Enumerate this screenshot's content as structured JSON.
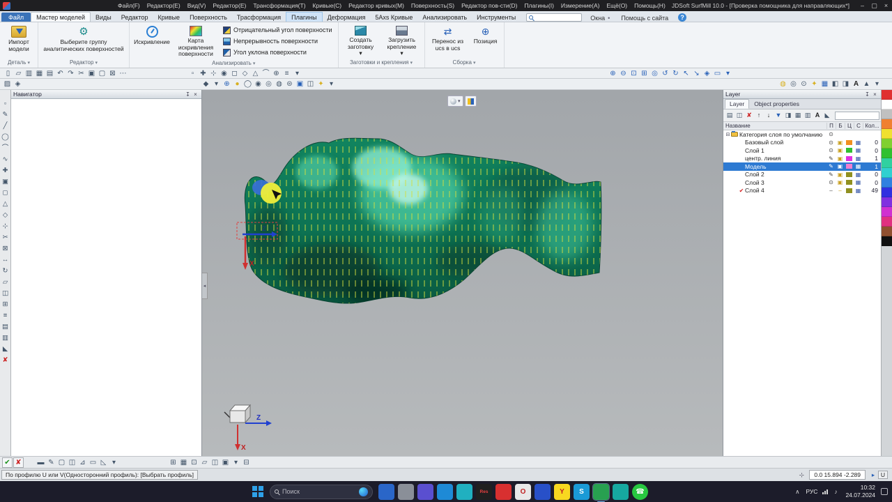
{
  "window": {
    "title": "JDSoft SurfMill 10.0 - [Проверка помощника для направляющих*]"
  },
  "menubar": {
    "items": [
      "Файл(F)",
      "Редактор(E)",
      "Вид(V)",
      "Редактор(E)",
      "Трансформация(T)",
      "Кривые(C)",
      "Редактор кривых(M)",
      "Поверхность(S)",
      "Редактор пов-сти(D)",
      "Плагины(I)",
      "Измерение(A)",
      "Ещё(O)",
      "Помощь(H)"
    ]
  },
  "tabs": {
    "items": [
      {
        "label": "Файл",
        "cls": "file"
      },
      {
        "label": "Мастер моделей",
        "cls": "active"
      },
      {
        "label": "Виды"
      },
      {
        "label": "Редактор"
      },
      {
        "label": "Кривые"
      },
      {
        "label": "Поверхность"
      },
      {
        "label": "Трасформация"
      },
      {
        "label": "Плагины",
        "cls": "hl"
      },
      {
        "label": "Деформация"
      },
      {
        "label": "5Axs Кривые"
      },
      {
        "label": "Анализировать"
      },
      {
        "label": "Инструменты"
      }
    ],
    "right_links": [
      "Окна",
      "Помощь с сайта"
    ]
  },
  "ribbon": {
    "import_btn": "Импорт модели",
    "select_btn": "Выберите группу аналитических поверхностей",
    "curvature_btn": "Искривление",
    "curvature_map_btn": "Карта искривления поверхности",
    "analyze_items": [
      "Отрицательный угол поверхности",
      "Непрерывность поверхности",
      "Угол уклона поверхности"
    ],
    "stock_btn": "Создать заготовку",
    "clamp_btn": "Загрузить крепление",
    "ucs_btn": "Перенос из ucs в ucs",
    "position_btn": "Позиция",
    "group_labels": [
      "Деталь",
      "Редактор",
      "Анализировать",
      "Заготовки и крепления",
      "Сборка"
    ]
  },
  "toolbar1": {
    "file_icons": [
      "▯",
      "▱",
      "▥",
      "▦",
      "▤",
      "↶",
      "↷",
      "✂",
      "▣",
      "▢",
      "⊠",
      "⋯"
    ],
    "select_icons": [
      "▫",
      "✚",
      "⊹",
      "◉",
      "◻",
      "◇",
      "△",
      "⌒",
      "⊕",
      "≡",
      "▾"
    ],
    "zoom_icons": [
      "⊕",
      "⊖",
      "⊡",
      "⊞",
      "◎",
      "↺",
      "↻",
      "↖",
      "↘",
      "◈",
      "▭",
      "▾"
    ]
  },
  "toolbar2": {
    "left_icons": [
      "▨",
      "◈"
    ],
    "render_icons": [
      {
        "g": "◆"
      },
      {
        "g": "▾"
      },
      {
        "g": "⊕",
        "cls": "blu"
      },
      {
        "g": "●",
        "cls": "yel"
      },
      {
        "g": "◯"
      },
      {
        "g": "◉"
      },
      {
        "g": "◎"
      },
      {
        "g": "◍"
      },
      {
        "g": "⊜"
      },
      {
        "g": "▣",
        "cls": "blu"
      },
      {
        "g": "◫"
      },
      {
        "g": "✦",
        "cls": "yel"
      },
      {
        "g": "▾"
      }
    ],
    "right_icons": [
      {
        "g": "◍",
        "cls": "yel"
      },
      {
        "g": "◎"
      },
      {
        "g": "⊙"
      },
      {
        "g": "✦",
        "cls": "yel"
      },
      {
        "g": "▦",
        "cls": "blu"
      },
      {
        "g": "◧"
      },
      {
        "g": "◨"
      },
      {
        "g": "A",
        "cls": "bold"
      },
      {
        "g": "▲"
      },
      {
        "g": "▾"
      }
    ]
  },
  "left_toolbar": {
    "icons": [
      "▫",
      "✎",
      "╱",
      "◯",
      "⌒",
      "∿",
      "✚",
      "▣",
      "◻",
      "△",
      "◇",
      "⊹",
      "✂",
      "⊠",
      "↔",
      "↻",
      "▱",
      "◫",
      "⊞",
      "≡",
      "▤",
      "▥",
      "◣",
      "✘"
    ]
  },
  "navigator": {
    "title": "Навигатор"
  },
  "viewport": {
    "axis_x": "X",
    "axis_z": "Z"
  },
  "layer_panel": {
    "title": "Layer",
    "tabs": [
      {
        "label": "Layer",
        "cls": "active"
      },
      {
        "label": "Object properties"
      }
    ],
    "toolbar": [
      {
        "g": "▤"
      },
      {
        "g": "◫"
      },
      {
        "g": "✘",
        "cls": "bad"
      },
      {
        "g": "↑",
        "cls": "bold"
      },
      {
        "g": "↓",
        "cls": "bold"
      },
      {
        "g": "▼",
        "cls": "blu"
      },
      {
        "g": "◨"
      },
      {
        "g": "▦"
      },
      {
        "g": "▥"
      },
      {
        "g": "A",
        "cls": "bold"
      },
      {
        "g": "◣"
      }
    ],
    "columns": [
      "Название",
      "П",
      "Б",
      "Ц",
      "С",
      "Кол..."
    ],
    "rows": [
      {
        "cls": "cat",
        "exp": "⊟",
        "name": "Категория слоя по умолчанию",
        "vis": "⊙",
        "lock": "",
        "grid": "",
        "count": ""
      },
      {
        "name": "Базовый слой",
        "vis": "⊙",
        "lock": "▣",
        "color": "#f09020",
        "grid": "▦",
        "count": "0"
      },
      {
        "name": "Слой 1",
        "vis": "⊙",
        "lock": "▣",
        "color": "#30c030",
        "grid": "▦",
        "count": "0"
      },
      {
        "name": "центр. линия",
        "vis": "✎",
        "lock": "▣",
        "color": "#e030e0",
        "grid": "▦",
        "count": "1"
      },
      {
        "cls": "sel",
        "name": "Модель",
        "vis": "✎",
        "lock": "▣",
        "color": "#f080d0",
        "grid": "▦",
        "count": "1"
      },
      {
        "name": "Слой 2",
        "vis": "✎",
        "lock": "▣",
        "color": "#909020",
        "grid": "▦",
        "count": "0"
      },
      {
        "name": "Слой 3",
        "vis": "⊙",
        "lock": "▣",
        "color": "#909020",
        "grid": "▦",
        "count": "0"
      },
      {
        "name": "Слой 4",
        "check": "✔",
        "vis": "–",
        "lock": "–",
        "color": "#909020",
        "grid": "▦",
        "count": "49"
      }
    ]
  },
  "color_strip": [
    "#e03030",
    "#ffffff",
    "#c0c0c0",
    "#f08030",
    "#f0e030",
    "#80d030",
    "#30c030",
    "#30d0a0",
    "#30d0d0",
    "#3080e0",
    "#3030e0",
    "#8030e0",
    "#d030d0",
    "#e03080",
    "#905030",
    "#101010"
  ],
  "bottom_bar": {
    "icons_confirm": [
      {
        "g": "✔",
        "cls": "ok"
      },
      {
        "g": "✘",
        "cls": "bad"
      }
    ],
    "icons_draw": [
      {
        "g": "▬"
      },
      {
        "g": "✎"
      },
      {
        "g": "▢"
      },
      {
        "g": "◫"
      },
      {
        "g": "⊿"
      },
      {
        "g": "▭"
      },
      {
        "g": "◺"
      },
      {
        "g": "▾"
      }
    ],
    "icons_snap": [
      {
        "g": "⊞"
      },
      {
        "g": "▦"
      },
      {
        "g": "⊡"
      },
      {
        "g": "▱"
      },
      {
        "g": "◫"
      },
      {
        "g": "▣"
      },
      {
        "g": "▾"
      },
      {
        "g": "⊟"
      }
    ]
  },
  "statusbar": {
    "message": "По профилю U или V(Односторонний профиль): [Выбрать профиль]",
    "coords": "0.0 15.894 -2.289",
    "mode": "U"
  },
  "taskbar": {
    "search": "Поиск",
    "apps": [
      {
        "bg": "#2a66c8"
      },
      {
        "bg": "#8a8f98"
      },
      {
        "bg": "#5a4fd0"
      },
      {
        "bg": "#1e8ad6"
      },
      {
        "bg": "#20b0c0"
      },
      {
        "bg": "#202020",
        "g": "Res",
        "cls": "res"
      },
      {
        "bg": "#d83030"
      },
      {
        "bg": "#e8e8e8",
        "g": "O",
        "cls": "dark"
      },
      {
        "bg": "#2850c8"
      },
      {
        "bg": "#f8d820",
        "g": "Y",
        "cls": "dark"
      },
      {
        "bg": "#1a9ad6",
        "g": "S"
      },
      {
        "bg": "#28a050",
        "cls": "active"
      },
      {
        "bg": "#16a8a0"
      },
      {
        "bg": "#28c840",
        "g": "☎",
        "cls": "round"
      }
    ],
    "lang": "РУС",
    "time": "10:32",
    "date": "24.07.2024"
  },
  "glyphs": {
    "dropdown": "▾",
    "pin": "↧",
    "close": "×",
    "help": "?",
    "dot": "•",
    "minimize": "–",
    "maximize": "▢",
    "gear": "⚙",
    "ucs_transfer": "⇄",
    "position_icon": "⊕",
    "collapse": "◂",
    "play": "▸",
    "target": "⊹",
    "chevron": "∧",
    "sound": "♪"
  }
}
